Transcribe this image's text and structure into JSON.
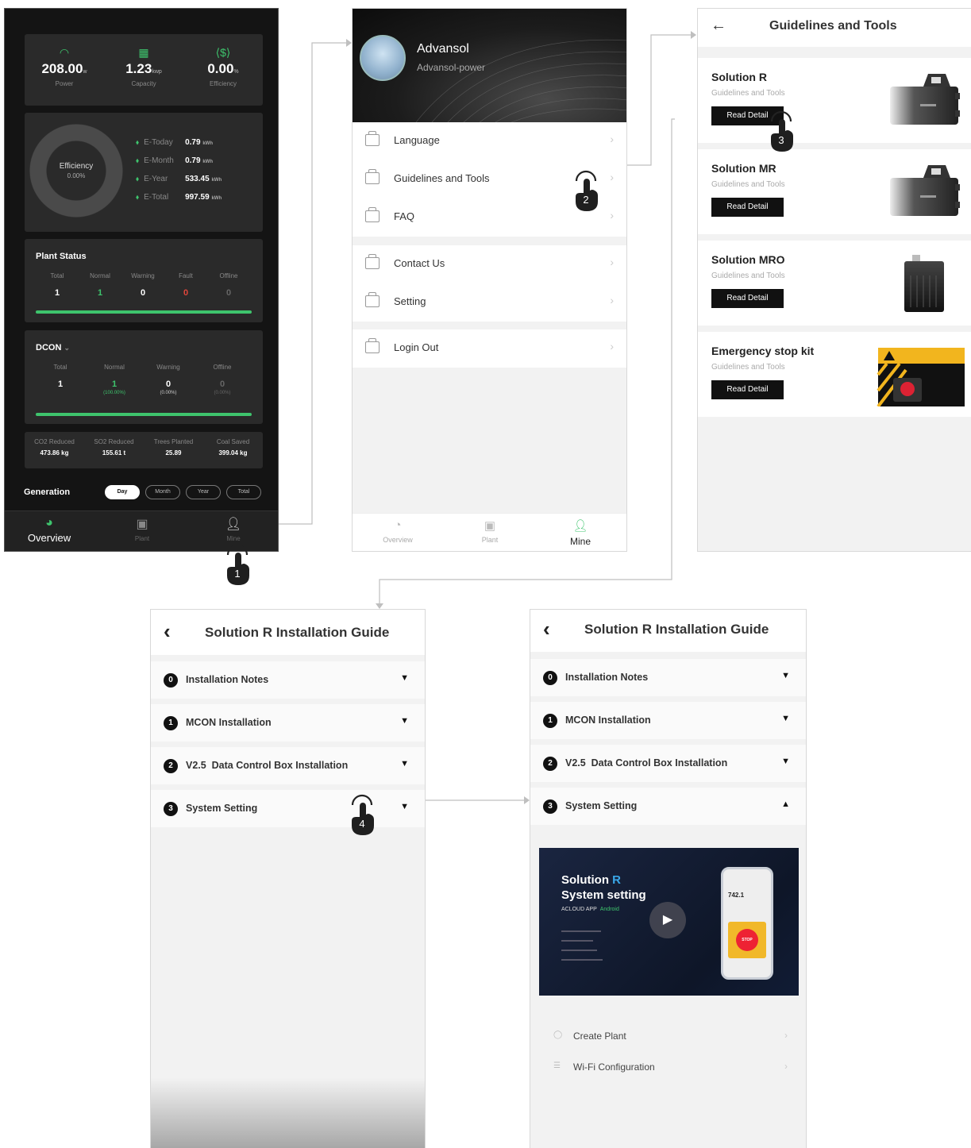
{
  "dashboard": {
    "metrics": [
      {
        "icon": "gauge-icon",
        "value": "208.00",
        "unit": "w",
        "label": "Power"
      },
      {
        "icon": "grid-icon",
        "value": "1.23",
        "unit": "kwp",
        "label": "Capacity"
      },
      {
        "icon": "efficiency-icon",
        "value": "0.00",
        "unit": "%",
        "label": "Efficiency"
      }
    ],
    "donut": {
      "label": "Efficiency",
      "value": "0.00%"
    },
    "energy": [
      {
        "label": "E-Today",
        "value": "0.79",
        "unit": "kWh"
      },
      {
        "label": "E-Month",
        "value": "0.79",
        "unit": "kWh"
      },
      {
        "label": "E-Year",
        "value": "533.45",
        "unit": "kWh"
      },
      {
        "label": "E-Total",
        "value": "997.59",
        "unit": "kWh"
      }
    ],
    "plant_status": {
      "title": "Plant Status",
      "headers": [
        "Total",
        "Normal",
        "Warning",
        "Fault",
        "Offline"
      ],
      "values": [
        "1",
        "1",
        "0",
        "0",
        "0"
      ]
    },
    "dcon": {
      "title": "DCON",
      "headers": [
        "Total",
        "Normal",
        "Warning",
        "Offline"
      ],
      "values": [
        "1",
        "1",
        "0",
        "0"
      ],
      "percents": [
        "",
        "(100.00%)",
        "(0.00%)",
        "(0.00%)"
      ]
    },
    "environment": [
      {
        "label": "CO2 Reduced",
        "value": "473.86 kg"
      },
      {
        "label": "SO2 Reduced",
        "value": "155.61 t"
      },
      {
        "label": "Trees Planted",
        "value": "25.89"
      },
      {
        "label": "Coal Saved",
        "value": "399.04 kg"
      }
    ],
    "generation": {
      "title": "Generation",
      "tabs": [
        "Day",
        "Month",
        "Year",
        "Total"
      ],
      "active": "Day"
    },
    "nav": [
      "Overview",
      "Plant",
      "Mine"
    ]
  },
  "profile": {
    "name": "Advansol",
    "subtitle": "Advansol-power",
    "menu": [
      "Language",
      "Guidelines and Tools",
      "FAQ",
      "Contact Us",
      "Setting",
      "Login Out"
    ],
    "nav": [
      "Overview",
      "Plant",
      "Mine"
    ]
  },
  "guidelines": {
    "title": "Guidelines and Tools",
    "cards": [
      {
        "title": "Solution R",
        "subtitle": "Guidelines and Tools",
        "button": "Read Detail"
      },
      {
        "title": "Solution MR",
        "subtitle": "Guidelines and Tools",
        "button": "Read Detail"
      },
      {
        "title": "Solution MRO",
        "subtitle": "Guidelines and Tools",
        "button": "Read Detail"
      },
      {
        "title": "Emergency stop kit",
        "subtitle": "Guidelines and Tools",
        "button": "Read Detail"
      }
    ]
  },
  "guide": {
    "title": "Solution R Installation Guide",
    "sections": [
      {
        "num": "0",
        "label": "Installation Notes"
      },
      {
        "num": "1",
        "label": "MCON Installation"
      },
      {
        "num": "2",
        "label": "V2.5  Data Control Box Installation"
      },
      {
        "num": "3",
        "label": "System Setting"
      }
    ],
    "video": {
      "line1_a": "Solution ",
      "line1_b": "R",
      "line2": "System setting",
      "app": "ACLOUD APP",
      "platform": "Android",
      "phone_value": "742.1",
      "stop": "STOP"
    },
    "links": [
      "Create Plant",
      "Wi-Fi Configuration"
    ]
  },
  "steps": [
    "1",
    "2",
    "3",
    "4"
  ],
  "colors": {
    "accent": "#3ec46d",
    "dark_bg": "#141414",
    "card_bg": "#2a2a2a",
    "button": "#111111",
    "fault": "#e0463c"
  }
}
